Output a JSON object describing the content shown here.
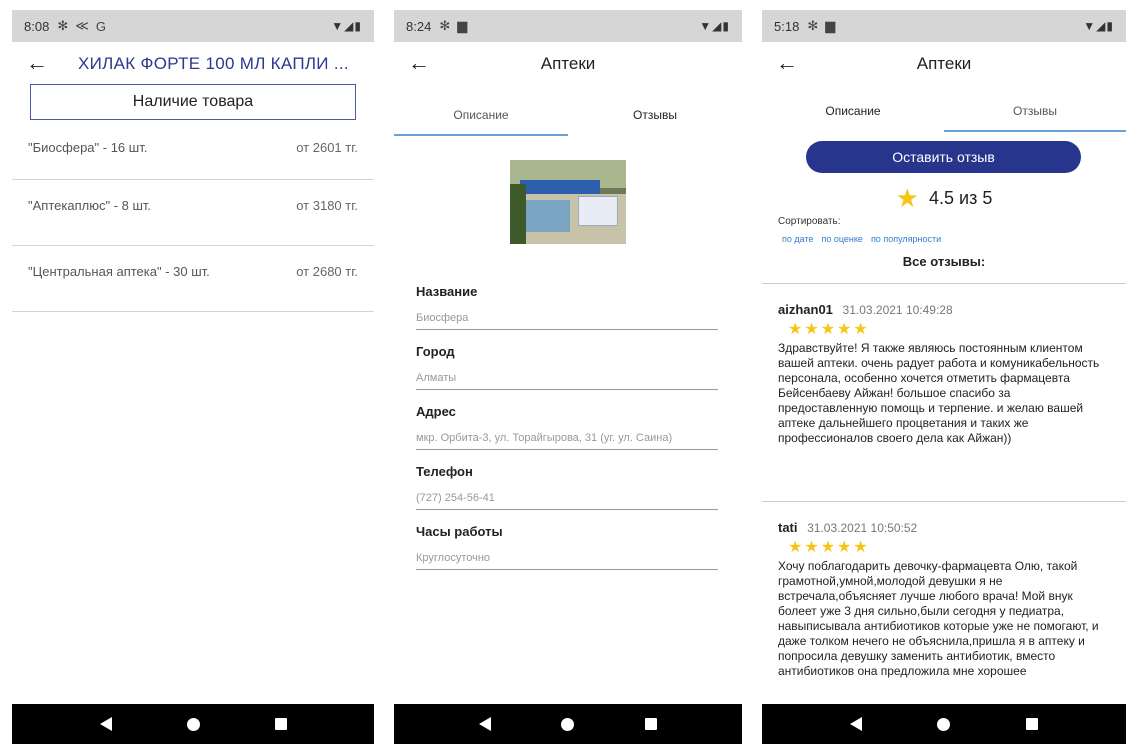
{
  "screen1": {
    "status": {
      "time": "8:08",
      "icons": [
        "gear-icon",
        "share-icon",
        "g-icon"
      ]
    },
    "title": "ХИЛАК ФОРТЕ 100 МЛ КАПЛИ ...",
    "stock_button": "Наличие товара",
    "items": [
      {
        "name": "\"Биосфера\" - 16 шт.",
        "price": "от 2601 тг."
      },
      {
        "name": "\"Аптекаплюс\" - 8 шт.",
        "price": "от 3180 тг."
      },
      {
        "name": "\"Центральная аптека\" - 30 шт.",
        "price": "от 2680 тг."
      }
    ]
  },
  "screen2": {
    "status": {
      "time": "8:24"
    },
    "title": "Аптеки",
    "tabs": [
      "Описание",
      "Отзывы"
    ],
    "fields": [
      {
        "label": "Название",
        "value": "Биосфера"
      },
      {
        "label": "Город",
        "value": "Алматы"
      },
      {
        "label": "Адрес",
        "value": "мкр. Орбита-3, ул. Торайгырова, 31 (уг. ул. Саина)"
      },
      {
        "label": "Телефон",
        "value": "(727) 254-56-41"
      },
      {
        "label": "Часы работы",
        "value": "Круглосуточно"
      }
    ]
  },
  "screen3": {
    "status": {
      "time": "5:18"
    },
    "title": "Аптеки",
    "tabs": [
      "Описание",
      "Отзывы"
    ],
    "review_button": "Оставить отзыв",
    "rating": "4.5 из 5",
    "sort_label": "Сортировать:",
    "sort_options": [
      "по дате",
      "по оценке",
      "по популярности"
    ],
    "all_reviews": "Все отзывы:",
    "reviews": [
      {
        "user": "aizhan01",
        "date": "31.03.2021 10:49:28",
        "stars": "★★★★★",
        "text": "Здравствуйте! Я также являюсь постоянным клиентом вашей аптеки. очень радует работа и комуникабельность персонала, особенно хочется отметить фармацевта Бейсенбаеву Айжан! большое спасибо за предоставленную помощь и терпение. и желаю вашей аптеке дальнейшего процветания и таких же профессионалов своего дела как Айжан))"
      },
      {
        "user": "tati",
        "date": "31.03.2021 10:50:52",
        "stars": "★★★★★",
        "text": "Хочу поблагодарить девочку-фармацевта Олю, такой грамотной,умной,молодой девушки я не встречала,объясняет лучше любого врача! Мой внук болеет уже 3 дня сильно,были сегодня у педиатра, навыписывала антибиотиков которые уже не помогают, и даже толком нечего не объяснила,пришла я в аптеку и попросила девушку заменить антибиотик, вместо антибиотиков она предложила мне хорошее"
      }
    ]
  },
  "colors": {
    "brand": "#27358c",
    "accent": "#6aa0d8",
    "star": "#f5c518",
    "link": "#2f7fd0"
  }
}
